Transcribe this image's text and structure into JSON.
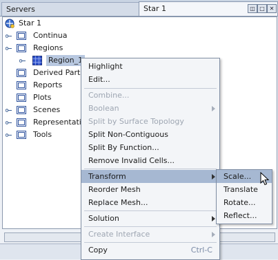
{
  "tabs": {
    "servers": "Servers",
    "star": "Star 1"
  },
  "window_buttons": [
    "restore-icon",
    "maximize-icon",
    "close-icon"
  ],
  "tree": {
    "root": "Star 1",
    "nodes": [
      {
        "label": "Continua"
      },
      {
        "label": "Regions"
      },
      {
        "label": "Region_1"
      },
      {
        "label": "Derived Parts"
      },
      {
        "label": "Reports"
      },
      {
        "label": "Plots"
      },
      {
        "label": "Scenes"
      },
      {
        "label": "Representations"
      },
      {
        "label": "Tools"
      }
    ]
  },
  "context_menu": {
    "items": [
      {
        "label": "Highlight",
        "enabled": true
      },
      {
        "label": "Edit...",
        "enabled": true
      },
      {
        "label": "Combine...",
        "enabled": false
      },
      {
        "label": "Boolean",
        "enabled": false
      },
      {
        "label": "Split by Surface Topology",
        "enabled": false
      },
      {
        "label": "Split Non-Contiguous",
        "enabled": true
      },
      {
        "label": "Split By Function...",
        "enabled": true
      },
      {
        "label": "Remove Invalid Cells...",
        "enabled": true
      },
      {
        "label": "Transform",
        "enabled": true
      },
      {
        "label": "Reorder Mesh",
        "enabled": true
      },
      {
        "label": "Replace Mesh...",
        "enabled": true
      },
      {
        "label": "Solution",
        "enabled": true
      },
      {
        "label": "Create Interface",
        "enabled": false
      },
      {
        "label": "Copy",
        "enabled": true,
        "shortcut": "Ctrl-C"
      }
    ]
  },
  "transform_submenu": {
    "items": [
      {
        "label": "Scale..."
      },
      {
        "label": "Translate"
      },
      {
        "label": "Rotate..."
      },
      {
        "label": "Reflect..."
      }
    ]
  },
  "colors": {
    "menu_highlight": "#a6b8d2",
    "folder": "#2a4f9c",
    "region_icon": "#3355cc"
  }
}
